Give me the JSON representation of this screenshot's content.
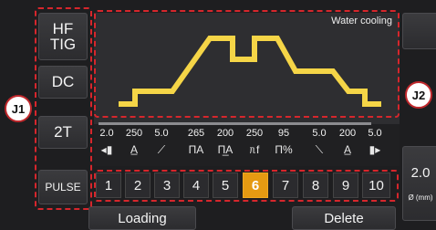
{
  "left_buttons": [
    "HF\nTIG",
    "DC",
    "2T",
    "PULSE"
  ],
  "graph": {
    "status": "Water cooling",
    "line_color": "#f5d547"
  },
  "params": {
    "values": [
      "2.0",
      "250",
      "5.0",
      "265",
      "200",
      "250",
      "95",
      "5.0",
      "200",
      "5.0"
    ],
    "symbols": [
      {
        "icon": "pre-gas-icon",
        "text": "◂▮"
      },
      {
        "icon": "start-current-icon",
        "text": "A̲"
      },
      {
        "icon": "upslope-icon",
        "text": "⟋"
      },
      {
        "icon": "peak-current-icon",
        "text": "ПA"
      },
      {
        "icon": "base-current-icon",
        "text": "П̲A"
      },
      {
        "icon": "pulse-frequency-icon",
        "text": "ᥰf"
      },
      {
        "icon": "duty-cycle-icon",
        "text": "П%"
      },
      {
        "icon": "downslope-icon",
        "text": "⟍"
      },
      {
        "icon": "crater-current-icon",
        "text": "A̲"
      },
      {
        "icon": "post-gas-icon",
        "text": "▮▸"
      }
    ]
  },
  "numbers": [
    "1",
    "2",
    "3",
    "4",
    "5",
    "6",
    "7",
    "8",
    "9",
    "10"
  ],
  "active_number": "6",
  "annotations": {
    "j1": "J1",
    "j2": "J2"
  },
  "right": {
    "diameter": "2.0",
    "unit": "Ø (mm)"
  },
  "bottom": {
    "loading": "Loading",
    "delete": "Delete"
  },
  "colors": {
    "accent": "#e59a12",
    "dash": "#d6262c"
  }
}
